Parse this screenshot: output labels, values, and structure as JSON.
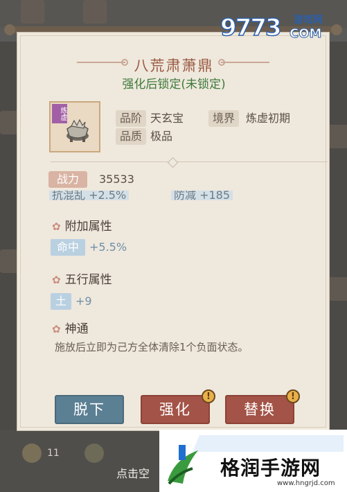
{
  "item": {
    "name": "八荒肃萧鼎",
    "lock_status": "强化后锁定(未锁定)",
    "badge": "炼虚",
    "grade_label": "品阶",
    "grade_value": "天玄宝",
    "realm_label": "境界",
    "realm_value": "炼虚初期",
    "quality_label": "品质",
    "quality_value": "极品"
  },
  "power": {
    "label": "战力",
    "value": "35533"
  },
  "cut_off_row": {
    "left": "抗混乱 +2.5%",
    "right": "防减 +185"
  },
  "sections": {
    "extra": {
      "title": "附加属性",
      "chip": "命中",
      "value": "+5.5%"
    },
    "element": {
      "title": "五行属性",
      "chip": "土",
      "value": "+9"
    },
    "skill": {
      "title": "神通",
      "description": "施放后立即为己方全体清除1个负面状态。"
    }
  },
  "buttons": {
    "remove": "脱下",
    "enhance": "强化",
    "swap": "替换",
    "alert_mark": "!"
  },
  "background": {
    "hint": "点击空",
    "count": "11"
  },
  "watermarks": {
    "top_digits": "9773",
    "top_site": "游戏网",
    "top_com": "COM",
    "bottom_name": "格润手游网",
    "bottom_url": "www.hngrjd.com"
  },
  "colors": {
    "title": "#9a5a43",
    "lock_status": "#3c7a3a",
    "remove_button": "#5b7f93",
    "action_button": "#a35347"
  }
}
